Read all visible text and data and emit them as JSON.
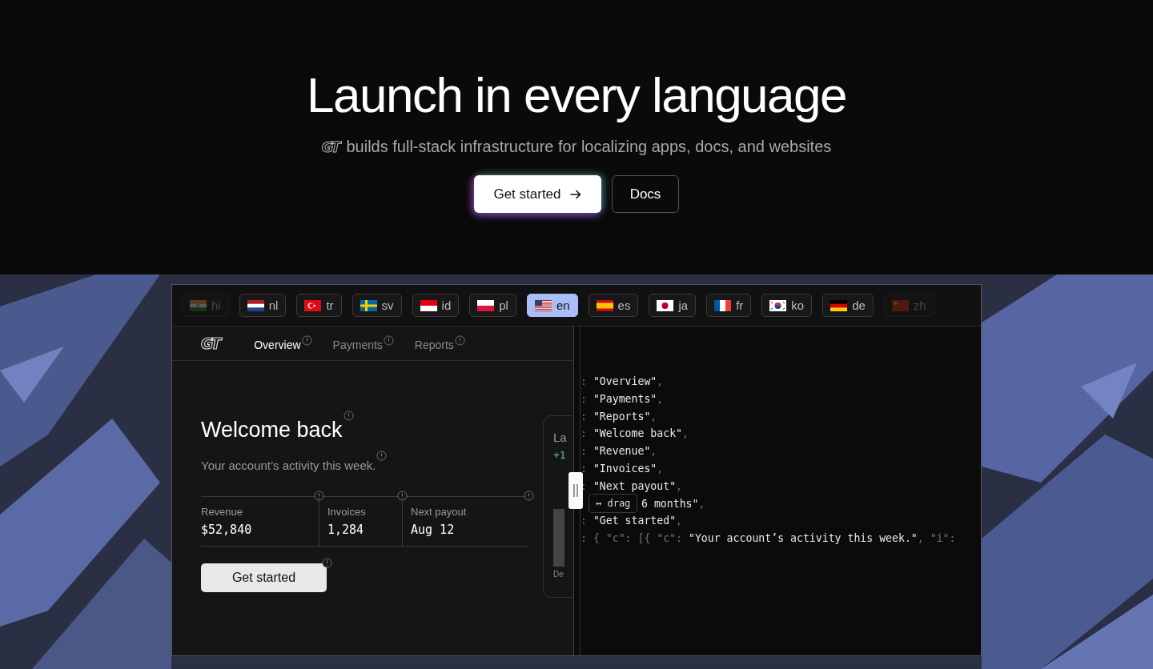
{
  "hero": {
    "title": "Launch in every language",
    "logo": "GT",
    "subtitle": "builds full-stack infrastructure for localizing apps, docs, and websites",
    "buttons": [
      {
        "label": "Get started",
        "kind": "primary"
      },
      {
        "label": "Docs",
        "kind": "secondary"
      }
    ]
  },
  "languages": [
    {
      "code": "hi",
      "kind": "in",
      "selected": false,
      "faded": true
    },
    {
      "code": "nl",
      "kind": "nl",
      "selected": false,
      "faded": false
    },
    {
      "code": "tr",
      "kind": "tr",
      "selected": false,
      "faded": false
    },
    {
      "code": "sv",
      "kind": "se",
      "selected": false,
      "faded": false
    },
    {
      "code": "id",
      "kind": "id",
      "selected": false,
      "faded": false
    },
    {
      "code": "pl",
      "kind": "pl",
      "selected": false,
      "faded": false
    },
    {
      "code": "en",
      "kind": "us",
      "selected": true,
      "faded": false
    },
    {
      "code": "es",
      "kind": "es",
      "selected": false,
      "faded": false
    },
    {
      "code": "ja",
      "kind": "jp",
      "selected": false,
      "faded": false
    },
    {
      "code": "fr",
      "kind": "fr",
      "selected": false,
      "faded": false
    },
    {
      "code": "ko",
      "kind": "kr",
      "selected": false,
      "faded": false
    },
    {
      "code": "de",
      "kind": "de",
      "selected": false,
      "faded": false
    },
    {
      "code": "zh",
      "kind": "cn",
      "selected": false,
      "faded": true
    }
  ],
  "app": {
    "logo": "GT",
    "tabs": [
      {
        "label": "Overview",
        "selected": true
      },
      {
        "label": "Payments",
        "selected": false
      },
      {
        "label": "Reports",
        "selected": false
      }
    ],
    "heading": "Welcome back",
    "subheading": "Your account’s activity this week.",
    "stats": [
      {
        "label": "Revenue",
        "value": "$52,840"
      },
      {
        "label": "Invoices",
        "value": "1,284"
      },
      {
        "label": "Next payout",
        "value": "Aug 12"
      }
    ],
    "button": "Get started"
  },
  "side_card": {
    "title": "La",
    "delta": "+1",
    "axis_label": "De"
  },
  "drag": {
    "label": "↔ drag"
  },
  "code_lines": [
    {
      "kind": "plain",
      "segments": [
        {
          "text": ": ",
          "bright": false
        },
        {
          "text": "\"Overview\"",
          "bright": true
        },
        {
          "text": ",",
          "bright": false
        }
      ]
    },
    {
      "kind": "plain",
      "segments": [
        {
          "text": ": ",
          "bright": false
        },
        {
          "text": "\"Payments\"",
          "bright": true
        },
        {
          "text": ",",
          "bright": false
        }
      ]
    },
    {
      "kind": "plain",
      "segments": [
        {
          "text": ": ",
          "bright": false
        },
        {
          "text": "\"Reports\"",
          "bright": true
        },
        {
          "text": ",",
          "bright": false
        }
      ]
    },
    {
      "kind": "plain",
      "segments": [
        {
          "text": ": ",
          "bright": false
        },
        {
          "text": "\"Welcome back\"",
          "bright": true
        },
        {
          "text": ",",
          "bright": false
        }
      ]
    },
    {
      "kind": "plain",
      "segments": [
        {
          "text": ": ",
          "bright": false
        },
        {
          "text": "\"Revenue\"",
          "bright": true
        },
        {
          "text": ",",
          "bright": false
        }
      ]
    },
    {
      "kind": "plain",
      "segments": [
        {
          "text": ": ",
          "bright": false
        },
        {
          "text": "\"Invoices\"",
          "bright": true
        },
        {
          "text": ",",
          "bright": false
        }
      ]
    },
    {
      "kind": "plain",
      "segments": [
        {
          "text": ": ",
          "bright": false
        },
        {
          "text": "\"Next payout\"",
          "bright": true
        },
        {
          "text": ",",
          "bright": false
        }
      ]
    },
    {
      "kind": "covered",
      "segments": [
        {
          "text": "6 months\"",
          "bright": true
        },
        {
          "text": ",",
          "bright": false
        }
      ]
    },
    {
      "kind": "plain",
      "segments": [
        {
          "text": ": ",
          "bright": false
        },
        {
          "text": "\"Get started\"",
          "bright": true
        },
        {
          "text": ",",
          "bright": false
        }
      ]
    },
    {
      "kind": "plain",
      "segments": [
        {
          "text": ": { \"c\": [{ \"c\": ",
          "bright": false
        },
        {
          "text": "\"Your account’s activity this week.\"",
          "bright": true
        },
        {
          "text": ", \"i\":",
          "bright": false
        }
      ]
    }
  ]
}
